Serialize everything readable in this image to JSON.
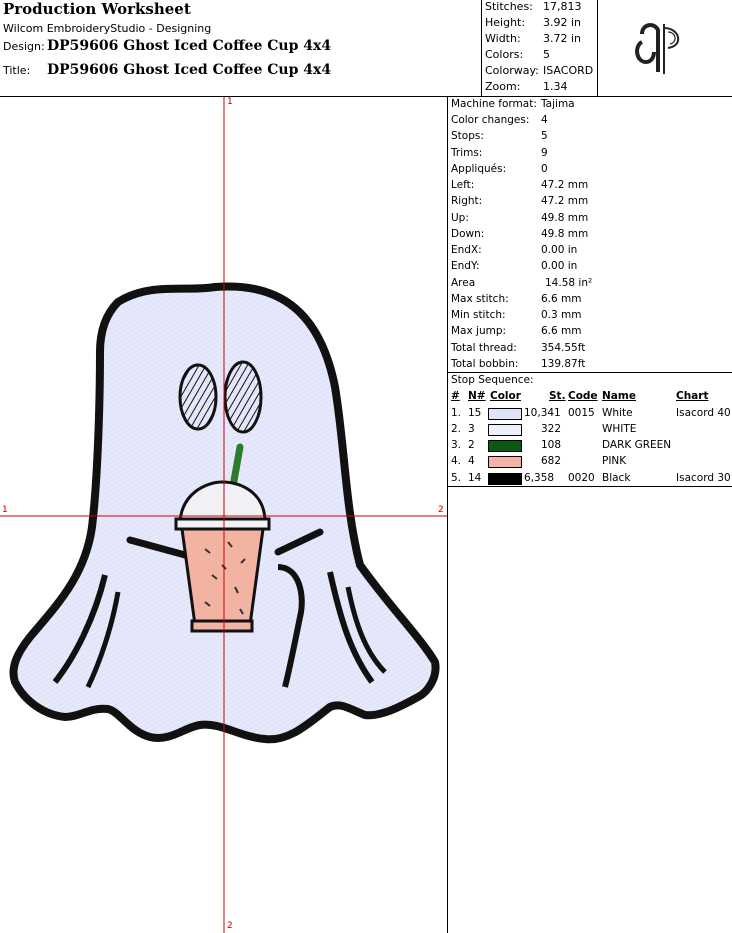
{
  "header": {
    "title": "Production Worksheet",
    "software": "Wilcom EmbroideryStudio - Designing",
    "design_label": "Design:",
    "design_value": "DP59606 Ghost Iced Coffee Cup 4x4",
    "title_label": "Title:",
    "title_value": "DP59606 Ghost Iced Coffee Cup 4x4"
  },
  "summary": [
    {
      "label": "Stitches:",
      "value": "17,813"
    },
    {
      "label": "Height:",
      "value": "3.92 in"
    },
    {
      "label": "Width:",
      "value": "3.72 in"
    },
    {
      "label": "Colors:",
      "value": "5"
    },
    {
      "label": "Colorway:",
      "value": "ISACORD"
    },
    {
      "label": "Zoom:",
      "value": "1.34"
    }
  ],
  "details": [
    {
      "label": "Machine format:",
      "value": "Tajima"
    },
    {
      "label": "Color changes:",
      "value": "4"
    },
    {
      "label": "Stops:",
      "value": "5"
    },
    {
      "label": "Trims:",
      "value": "9"
    },
    {
      "label": "Appliqués:",
      "value": "0"
    },
    {
      "label": "Left:",
      "value": "47.2 mm"
    },
    {
      "label": "Right:",
      "value": "47.2 mm"
    },
    {
      "label": "Up:",
      "value": "49.8 mm"
    },
    {
      "label": "Down:",
      "value": "49.8 mm"
    },
    {
      "label": "EndX:",
      "value": "0.00 in"
    },
    {
      "label": "EndY:",
      "value": "0.00 in"
    },
    {
      "label": "Area",
      "value": "14.58 in²"
    },
    {
      "label": "Max stitch:",
      "value": "6.6 mm"
    },
    {
      "label": "Min stitch:",
      "value": "0.3 mm"
    },
    {
      "label": "Max jump:",
      "value": "6.6 mm"
    },
    {
      "label": "Total thread:",
      "value": "354.55ft"
    },
    {
      "label": "Total bobbin:",
      "value": "139.87ft"
    }
  ],
  "stop_sequence": {
    "title": "Stop Sequence:",
    "headers": {
      "num": "#",
      "n": "N#",
      "color": "Color",
      "st": "St.",
      "code": "Code",
      "name": "Name",
      "chart": "Chart"
    },
    "rows": [
      {
        "num": "1.",
        "n": "15",
        "color": "#dfe4f8",
        "st": "10,341",
        "code": "0015",
        "name": "White",
        "chart": "Isacord 40"
      },
      {
        "num": "2.",
        "n": "3",
        "color": "#eef1f8",
        "st": "322",
        "code": "",
        "name": "WHITE",
        "chart": ""
      },
      {
        "num": "3.",
        "n": "2",
        "color": "#0b5a14",
        "st": "108",
        "code": "",
        "name": "DARK GREEN",
        "chart": ""
      },
      {
        "num": "4.",
        "n": "4",
        "color": "#f4b3a6",
        "st": "682",
        "code": "",
        "name": "PINK",
        "chart": ""
      },
      {
        "num": "5.",
        "n": "14",
        "color": "#000000",
        "st": "6,358",
        "code": "0020",
        "name": "Black",
        "chart": "Isacord 30"
      }
    ]
  },
  "axis_labels": {
    "top": "1",
    "bottom": "2",
    "left": "1",
    "right": "2"
  },
  "colors": {
    "ghost_fill": "#e6e8fb",
    "outline": "#111111",
    "straw": "#2a7d2a",
    "drink": "#f2b3a2",
    "crosshair": "#d00000"
  }
}
